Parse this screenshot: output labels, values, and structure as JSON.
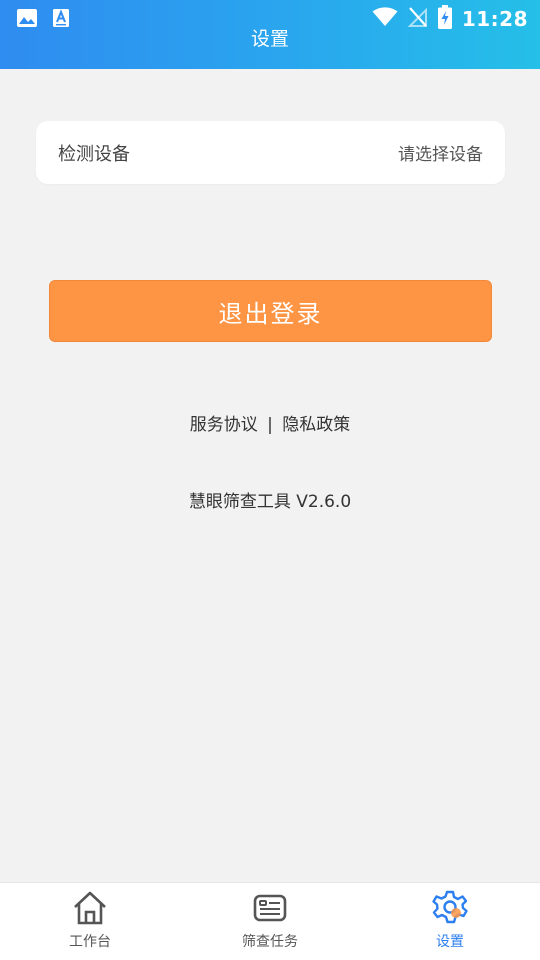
{
  "status_bar": {
    "time": "11:28",
    "left_icons": [
      "image-icon",
      "a-notification-icon"
    ],
    "right_icons": [
      "wifi-icon",
      "no-signal-icon",
      "battery-charging-icon"
    ]
  },
  "header": {
    "title": "设置"
  },
  "device_row": {
    "label": "检测设备",
    "value": "请选择设备"
  },
  "logout_button": {
    "label": "退出登录"
  },
  "links": {
    "service": "服务协议",
    "separator": "|",
    "privacy": "隐私政策"
  },
  "version_text": "慧眼筛查工具 V2.6.0",
  "tabbar": {
    "items": [
      {
        "label": "工作台",
        "icon": "home-icon",
        "active": false
      },
      {
        "label": "筛查任务",
        "icon": "task-icon",
        "active": false
      },
      {
        "label": "设置",
        "icon": "gear-icon",
        "active": true
      }
    ]
  },
  "colors": {
    "header_start": "#2f8cf0",
    "header_end": "#25bfe8",
    "logout_button": "#fd9545",
    "active_tab": "#2d7ff0",
    "background": "#f2f2f2"
  }
}
